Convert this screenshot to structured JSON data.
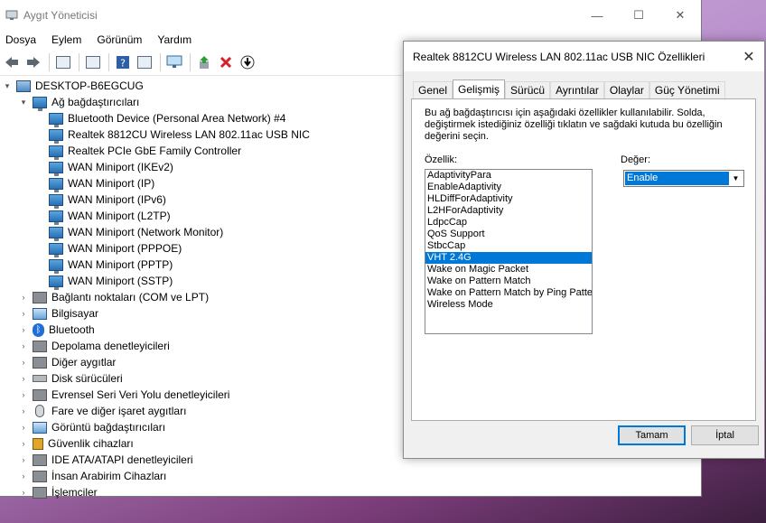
{
  "window": {
    "title": "Aygıt Yöneticisi",
    "controls": {
      "minimize": "—",
      "maximize": "☐",
      "close": "✕"
    }
  },
  "menu": [
    "Dosya",
    "Eylem",
    "Görünüm",
    "Yardım"
  ],
  "tree": {
    "root": "DESKTOP-B6EGCUG",
    "network_category": "Ağ bağdaştırıcıları",
    "network_items": [
      "Bluetooth Device (Personal Area Network) #4",
      "Realtek 8812CU Wireless LAN 802.11ac USB NIC",
      "Realtek PCIe GbE Family Controller",
      "WAN Miniport (IKEv2)",
      "WAN Miniport (IP)",
      "WAN Miniport (IPv6)",
      "WAN Miniport (L2TP)",
      "WAN Miniport (Network Monitor)",
      "WAN Miniport (PPPOE)",
      "WAN Miniport (PPTP)",
      "WAN Miniport (SSTP)"
    ],
    "categories": [
      "Bağlantı noktaları (COM ve LPT)",
      "Bilgisayar",
      "Bluetooth",
      "Depolama denetleyicileri",
      "Diğer aygıtlar",
      "Disk sürücüleri",
      "Evrensel Seri Veri Yolu denetleyicileri",
      "Fare ve diğer işaret aygıtları",
      "Görüntü bağdaştırıcıları",
      "Güvenlik cihazları",
      "IDE ATA/ATAPI denetleyicileri",
      "İnsan Arabirim Cihazları",
      "İşlemciler"
    ]
  },
  "dialog": {
    "title": "Realtek 8812CU Wireless LAN 802.11ac USB NIC Özellikleri",
    "close": "✕",
    "tabs": [
      "Genel",
      "Gelişmiş",
      "Sürücü",
      "Ayrıntılar",
      "Olaylar",
      "Güç Yönetimi"
    ],
    "active_tab": "Gelişmiş",
    "description": "Bu ağ bağdaştırıcısı için aşağıdaki özellikler kullanılabilir. Solda, değiştirmek istediğiniz özelliği tıklatın ve sağdaki kutuda bu özelliğin değerini seçin.",
    "property_label": "Özellik:",
    "value_label": "Değer:",
    "properties": [
      "AdaptivityPara",
      "EnableAdaptivity",
      "HLDiffForAdaptivity",
      "L2HForAdaptivity",
      "LdpcCap",
      "QoS Support",
      "StbcCap",
      "VHT 2.4G",
      "Wake on Magic Packet",
      "Wake on Pattern Match",
      "Wake on Pattern Match by Ping Patte",
      "Wireless Mode"
    ],
    "selected_property": "VHT 2.4G",
    "value": "Enable",
    "ok": "Tamam",
    "cancel": "İptal"
  }
}
